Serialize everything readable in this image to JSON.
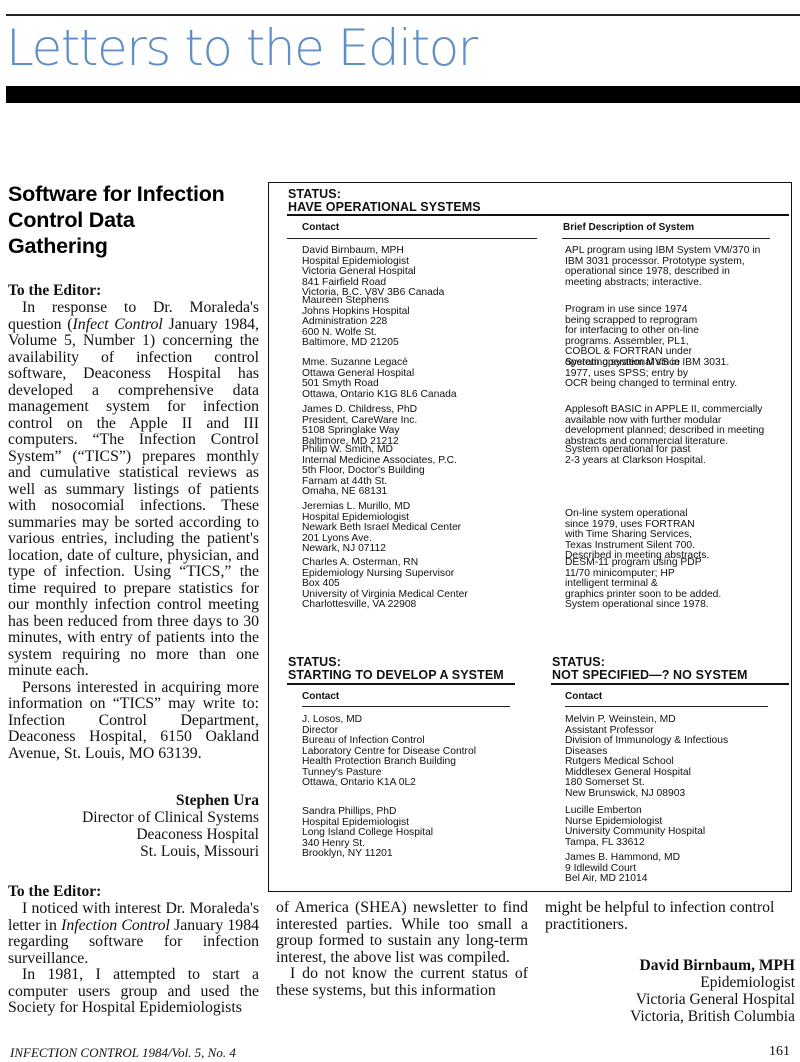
{
  "masthead": {
    "title": "Letters to the Editor"
  },
  "article": {
    "title_lines": [
      "Software for Infection",
      "Control Data",
      "Gathering"
    ]
  },
  "letter1": {
    "salutation": "To the Editor:",
    "p1_before_italic": "In response to Dr. Moraleda's question (",
    "p1_italic": "Infect Control",
    "p1_after_italic": " January 1984, Volume 5, Number 1) concerning the availability of infection control software, Deaconess Hospital has developed a comprehensive data management system for infection control on the Apple II and III computers. “The Infection Control System” (“TICS”) prepares monthly and cumulative statistical reviews as well as summary listings of patients with nosocomial infections. These summaries may be sorted according to various entries, including the patient's location, date of culture, physician, and type of infection. Using “TICS,” the time required to prepare statistics for our monthly infection control meeting has been reduced from three days to 30 minutes, with entry of patients into the system requiring no more than one minute each.",
    "p2": "Persons interested in acquiring more information on “TICS” may write to: Infection Control Department, Deaconess Hospital, 6150 Oakland Avenue, St. Louis, MO 63139.",
    "signature": {
      "name": "Stephen Ura",
      "lines": [
        "Director of Clinical Systems",
        "Deaconess Hospital",
        "St. Louis, Missouri"
      ]
    }
  },
  "status_box": {
    "operational": {
      "status_label": "STATUS:",
      "title": "HAVE OPERATIONAL SYSTEMS",
      "col_contact": "Contact",
      "col_description": "Brief Description of System",
      "entries": [
        {
          "contact": [
            "David Birnbaum, MPH",
            "Hospital Epidemiologist",
            "Victoria General Hospital",
            "841 Fairfield Road",
            "Victoria, B.C. V8V 3B6 Canada"
          ],
          "description": [
            "APL program using IBM System VM/370 in",
            "IBM 3031 processor. Prototype system,",
            "operational since 1978, described in",
            "meeting abstracts; interactive."
          ]
        },
        {
          "contact": [
            "Maureen Stephens",
            "Johns Hopkins Hospital",
            "Administration 228",
            "600 N. Wolfe St.",
            "Baltimore, MD 21205"
          ],
          "description": [
            "Program in use since 1974",
            "being scrapped to reprogram",
            "for interfacing to other on-line",
            "programs. Assembler, PL1,",
            "COBOL & FORTRAN under",
            "operating system MVS in IBM 3031."
          ]
        },
        {
          "contact": [
            "Mme. Suzanne Legacé",
            "Ottawa General Hospital",
            "501 Smyth Road",
            "Ottawa, Ontario K1G 8L6 Canada"
          ],
          "description": [
            "System operational since",
            "1977, uses SPSS; entry by",
            "OCR being changed to terminal entry."
          ]
        },
        {
          "contact": [
            "James D. Childress, PhD",
            "President, CareWare Inc.",
            "5108 Springlake Way",
            "Baltimore, MD 21212"
          ],
          "description": [
            "Applesoft BASIC in APPLE II, commercially",
            "available now with further modular",
            "development planned; described in meeting",
            "abstracts and commercial literature."
          ]
        },
        {
          "contact": [
            "Philip W. Smith, MD",
            "Internal Medicine Associates, P.C.",
            "5th Floor, Doctor's Building",
            "Farnam at 44th St.",
            "Omaha, NE 68131"
          ],
          "description": [
            "System operational for past",
            "2-3 years at Clarkson Hospital."
          ]
        },
        {
          "contact": [
            "Jeremias L. Murillo, MD",
            "Hospital Epidemiologist",
            "Newark Beth Israel Medical Center",
            "201 Lyons Ave.",
            "Newark, NJ 07112"
          ],
          "description": [
            "On-line system operational",
            "since 1979, uses FORTRAN",
            "with Time Sharing Services,",
            "Texas Instrument Silent 700.",
            "Described in meeting abstracts."
          ]
        },
        {
          "contact": [
            "Charles A. Osterman, RN",
            "Epidemiology Nursing Supervisor",
            "Box 405",
            "University of Virginia Medical Center",
            "Charlottesville, VA 22908"
          ],
          "description": [
            "DESM-11 program using PDP",
            "11/70 minicomputer; HP",
            "intelligent terminal &",
            "graphics printer soon to be added.",
            "System operational since 1978."
          ]
        }
      ]
    },
    "developing": {
      "status_label": "STATUS:",
      "title": "STARTING TO DEVELOP A SYSTEM",
      "col_contact": "Contact",
      "entries": [
        {
          "contact": [
            "J. Losos, MD",
            "Director",
            "Bureau of Infection Control",
            "Laboratory Centre for Disease Control",
            "Health Protection Branch Building",
            "Tunney's Pasture",
            "Ottawa, Ontario K1A 0L2"
          ]
        },
        {
          "contact": [
            "Sandra Phillips, PhD",
            "Hospital Epidemiologist",
            "Long Island College Hospital",
            "340 Henry St.",
            "Brooklyn, NY 11201"
          ]
        }
      ]
    },
    "not_specified": {
      "status_label": "STATUS:",
      "title": "NOT SPECIFIED—? NO SYSTEM",
      "col_contact": "Contact",
      "entries": [
        {
          "contact": [
            "Melvin P. Weinstein, MD",
            "Assistant Professor",
            "Division of Immunology & Infectious",
            "Diseases",
            "Rutgers Medical School",
            "Middlesex General Hospital",
            "180 Somerset St.",
            "New Brunswick, NJ 08903"
          ]
        },
        {
          "contact": [
            "Lucille Emberton",
            "Nurse Epidemiologist",
            "University Community Hospital",
            "Tampa, FL 33612"
          ]
        },
        {
          "contact": [
            "James B. Hammond, MD",
            "9 Idlewild Court",
            "Bel Air, MD 21014"
          ]
        }
      ]
    }
  },
  "letter2": {
    "salutation": "To the Editor:",
    "col1_p1_before_italic": "I noticed with interest Dr. Moraleda's letter in ",
    "col1_p1_italic": "Infection Control",
    "col1_p1_after_italic": " January 1984 regarding software for infection surveillance.",
    "col1_p2": "In 1981, I attempted to start a computer users group and used the Society for Hospital Epidemiologists",
    "col2_p1_cont": "of America (SHEA) newsletter to find interested parties. While too small a group formed to sustain any long-term interest, the above list was compiled.",
    "col2_p2": "I do not know the current status of these systems, but this information",
    "col3_p2_cont": "might be helpful to infection control practitioners.",
    "signature": {
      "name": "David Birnbaum, MPH",
      "lines": [
        "Epidemiologist",
        "Victoria General Hospital",
        "Victoria, British Columbia"
      ]
    }
  },
  "footer": {
    "journal": "INFECTION CONTROL 1984/Vol. 5, No. 4",
    "page_number": "161"
  }
}
